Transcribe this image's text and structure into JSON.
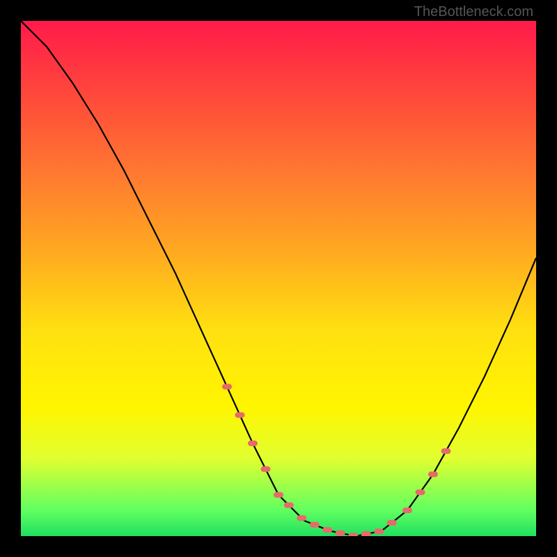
{
  "watermark": "TheBottleneck.com",
  "chart_data": {
    "type": "line",
    "title": "",
    "xlabel": "",
    "ylabel": "",
    "xlim": [
      0,
      100
    ],
    "ylim": [
      0,
      100
    ],
    "series": [
      {
        "name": "curve",
        "x": [
          0,
          5,
          10,
          15,
          20,
          25,
          30,
          35,
          40,
          45,
          50,
          55,
          60,
          65,
          70,
          75,
          80,
          85,
          90,
          95,
          100
        ],
        "y": [
          100,
          95,
          88,
          80,
          71,
          61,
          51,
          40,
          29,
          18,
          8,
          3,
          1,
          0,
          1,
          5,
          12,
          21,
          31,
          42,
          54
        ]
      }
    ],
    "marker_ranges": [
      {
        "x_start": 40,
        "x_end": 52,
        "side": "left"
      },
      {
        "x_start": 52,
        "x_end": 72,
        "side": "bottom"
      },
      {
        "x_start": 75,
        "x_end": 84,
        "side": "right"
      }
    ],
    "gradient_stops": [
      {
        "pos": 0,
        "color": "#ff1a4a"
      },
      {
        "pos": 15,
        "color": "#ff4a3a"
      },
      {
        "pos": 30,
        "color": "#ff7a30"
      },
      {
        "pos": 45,
        "color": "#ffaa20"
      },
      {
        "pos": 60,
        "color": "#ffe010"
      },
      {
        "pos": 75,
        "color": "#fff500"
      },
      {
        "pos": 85,
        "color": "#e0ff30"
      },
      {
        "pos": 95,
        "color": "#60ff60"
      },
      {
        "pos": 100,
        "color": "#20e060"
      }
    ]
  }
}
